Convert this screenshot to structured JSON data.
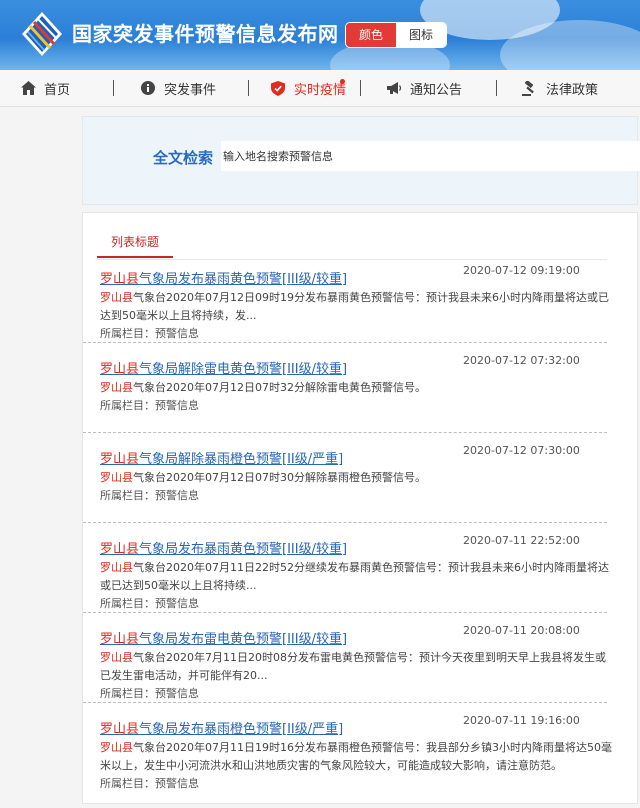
{
  "header": {
    "site_title": "国家突发事件预警信息发布网",
    "mode_color_label": "颜色",
    "mode_icon_label": "图标",
    "accent_color": "#e33a36",
    "brand_blue": "#2b7fd6"
  },
  "nav": {
    "items": [
      {
        "label": "首页",
        "icon": "home-icon"
      },
      {
        "label": "突发事件",
        "icon": "info-icon"
      },
      {
        "label": "实时疫情",
        "icon": "shield-icon",
        "active": true,
        "has_dot": true
      },
      {
        "label": "通知公告",
        "icon": "megaphone-icon"
      },
      {
        "label": "法律政策",
        "icon": "gavel-icon"
      }
    ]
  },
  "search": {
    "label": "全文检索",
    "placeholder": "输入地名搜索预警信息"
  },
  "list": {
    "tab_title": "列表标题",
    "items": [
      {
        "title_region": "罗山县",
        "title_rest": "气象局发布暴雨黄色预警[III级/较重]",
        "date": "2020-07-12 09:19:00",
        "summary_region": "罗山县",
        "summary_rest": "气象台2020年07月12日09时19分发布暴雨黄色预警信号：预计我县未来6小时内降雨量将达或已达到50毫米以上且将持续，发...",
        "category": "所属栏目：预警信息"
      },
      {
        "title_region": "罗山县",
        "title_rest": "气象局解除雷电黄色预警[III级/较重]",
        "date": "2020-07-12 07:32:00",
        "summary_region": "罗山县",
        "summary_rest": "气象台2020年07月12日07时32分解除雷电黄色预警信号。",
        "category": "所属栏目：预警信息"
      },
      {
        "title_region": "罗山县",
        "title_rest": "气象局解除暴雨橙色预警[II级/严重]",
        "date": "2020-07-12 07:30:00",
        "summary_region": "罗山县",
        "summary_rest": "气象台2020年07月12日07时30分解除暴雨橙色预警信号。",
        "category": "所属栏目：预警信息"
      },
      {
        "title_region": "罗山县",
        "title_rest": "气象局发布暴雨黄色预警[III级/较重]",
        "date": "2020-07-11 22:52:00",
        "summary_region": "罗山县",
        "summary_rest": "气象台2020年07月11日22时52分继续发布暴雨黄色预警信号：预计我县未来6小时内降雨量将达或已达到50毫米以上且将持续...",
        "category": "所属栏目：预警信息"
      },
      {
        "title_region": "罗山县",
        "title_rest": "气象局发布雷电黄色预警[III级/较重]",
        "date": "2020-07-11 20:08:00",
        "summary_region": "罗山县",
        "summary_rest": "气象台2020年7月11日20时08分发布雷电黄色预警信号：预计今天夜里到明天早上我县将发生或已发生雷电活动，并可能伴有20...",
        "category": "所属栏目：预警信息"
      },
      {
        "title_region": "罗山县",
        "title_rest": "气象局发布暴雨橙色预警[II级/严重]",
        "date": "2020-07-11 19:16:00",
        "summary_region": "罗山县",
        "summary_rest": "气象台2020年07月11日19时16分发布暴雨橙色预警信号：我县部分乡镇3小时内降雨量将达50毫米以上，发生中小河流洪水和山洪地质灾害的气象风险较大，可能造成较大影响，请注意防范。",
        "category": "所属栏目：预警信息"
      }
    ]
  }
}
